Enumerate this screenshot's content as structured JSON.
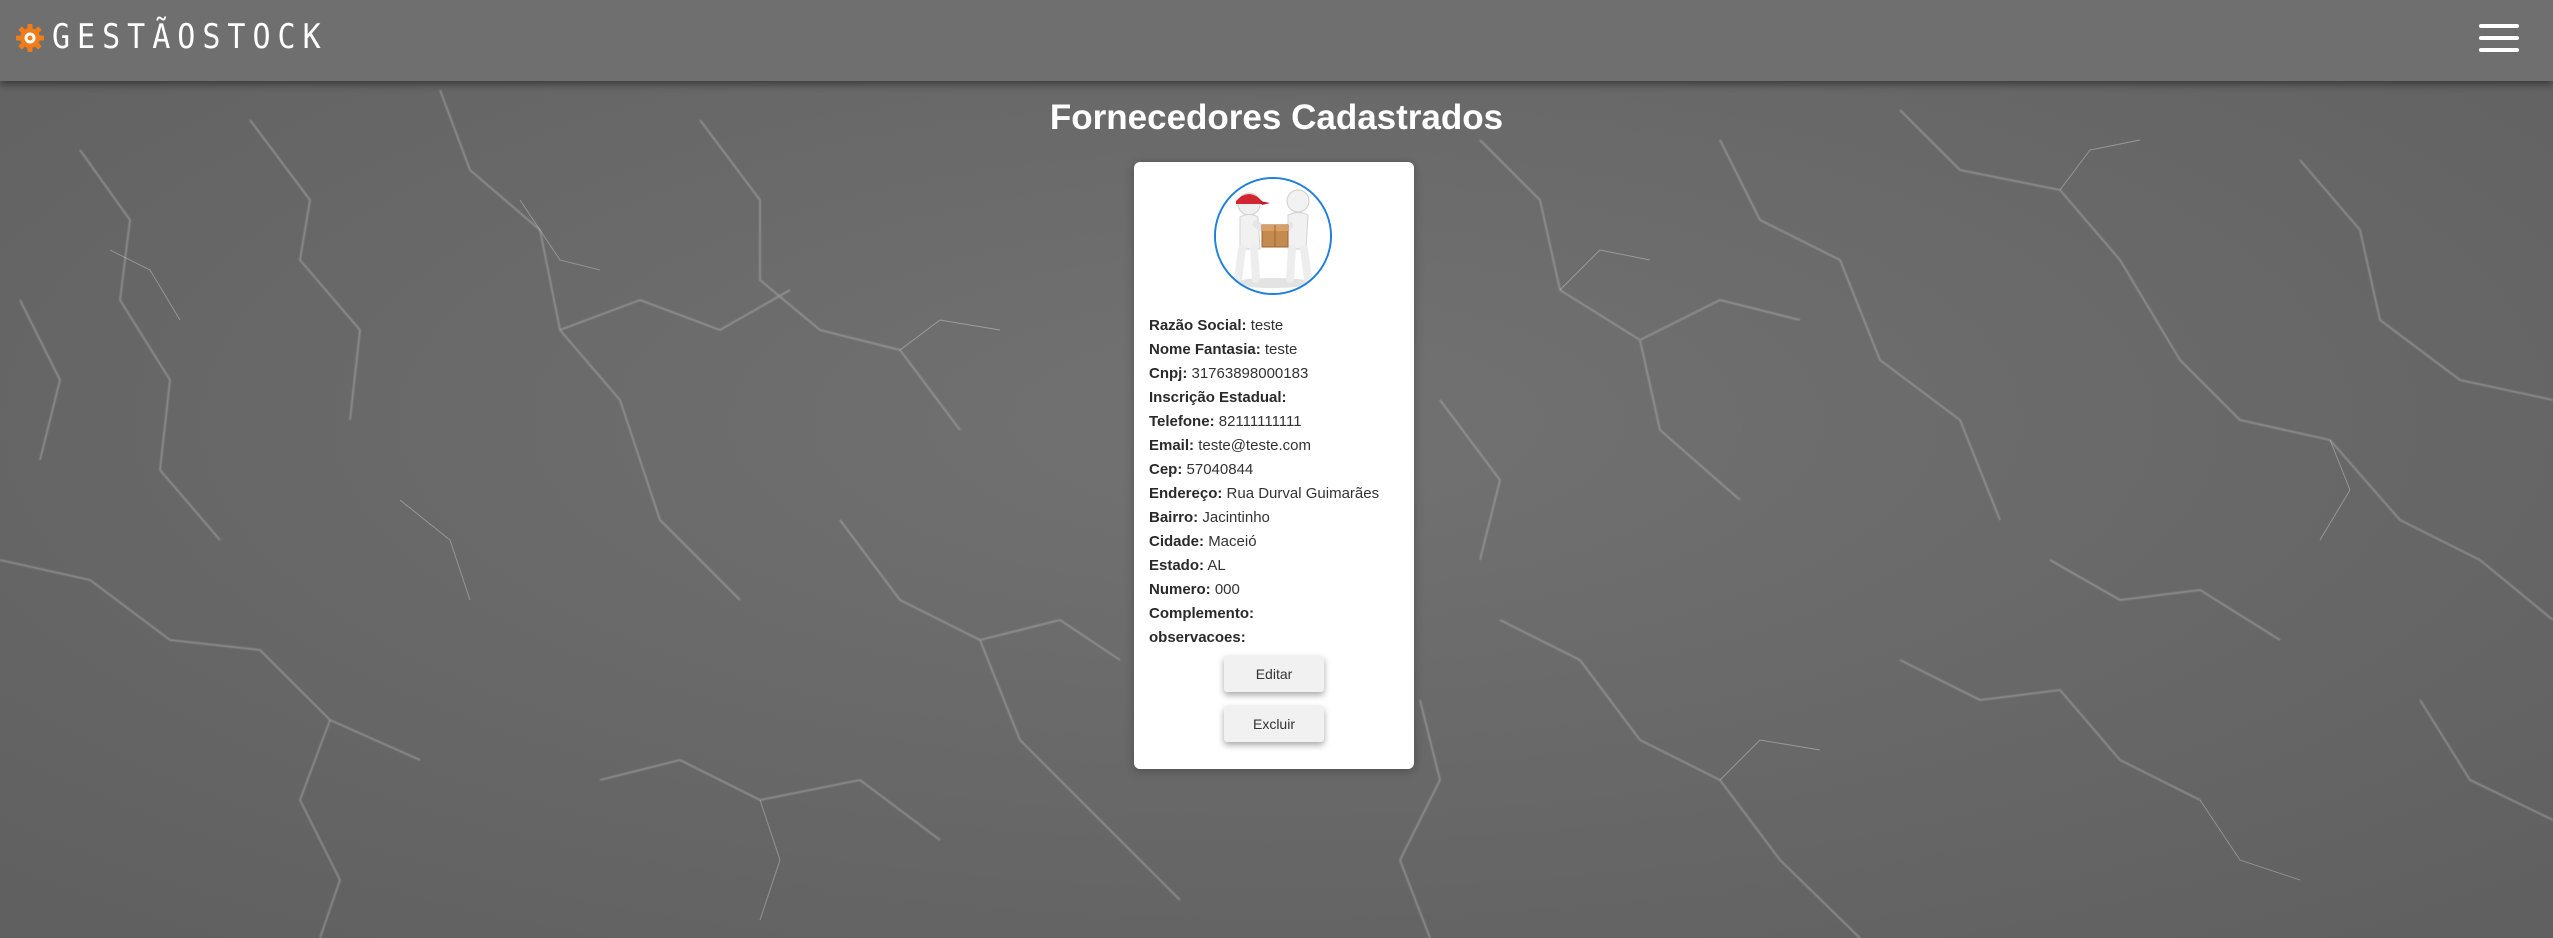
{
  "header": {
    "brand_name": "GESTÃOSTOCK",
    "logo_icon": "gear-icon",
    "menu_icon": "hamburger-menu-icon",
    "accent_color": "#f07d1a"
  },
  "page": {
    "title": "Fornecedores Cadastrados"
  },
  "supplier": {
    "avatar_icon": "delivery-people-with-box-image",
    "fields": [
      {
        "label": "Razão Social:",
        "value": "teste"
      },
      {
        "label": "Nome Fantasia:",
        "value": "teste"
      },
      {
        "label": "Cnpj:",
        "value": "31763898000183"
      },
      {
        "label": "Inscrição Estadual:",
        "value": ""
      },
      {
        "label": "Telefone:",
        "value": "82111111111"
      },
      {
        "label": "Email:",
        "value": "teste@teste.com"
      },
      {
        "label": "Cep:",
        "value": "57040844"
      },
      {
        "label": "Endereço:",
        "value": "Rua Durval Guimarães"
      },
      {
        "label": "Bairro:",
        "value": "Jacintinho"
      },
      {
        "label": "Cidade:",
        "value": "Maceió"
      },
      {
        "label": "Estado:",
        "value": "AL"
      },
      {
        "label": "Numero:",
        "value": "000"
      },
      {
        "label": "Complemento:",
        "value": ""
      },
      {
        "label": "observacoes:",
        "value": ""
      }
    ],
    "edit_label": "Editar",
    "delete_label": "Excluir",
    "avatar_border_color": "#1f7fe0"
  }
}
